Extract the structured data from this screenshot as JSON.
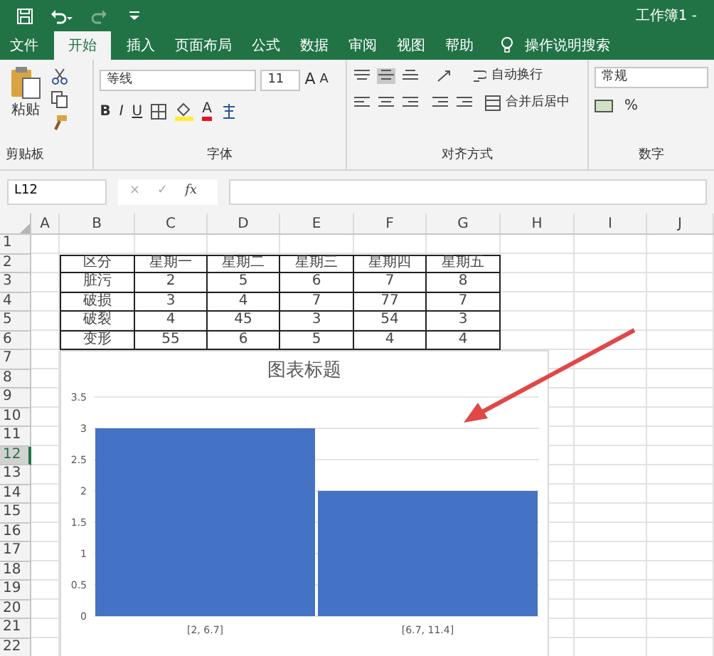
{
  "window": {
    "title": "工作簿1 -"
  },
  "tabs": [
    {
      "label": "文件",
      "selected": false
    },
    {
      "label": "开始",
      "selected": true
    },
    {
      "label": "插入",
      "selected": false
    },
    {
      "label": "页面布局",
      "selected": false
    },
    {
      "label": "公式",
      "selected": false
    },
    {
      "label": "数据",
      "selected": false
    },
    {
      "label": "审阅",
      "selected": false
    },
    {
      "label": "视图",
      "selected": false
    },
    {
      "label": "帮助",
      "selected": false
    }
  ],
  "tell_me": "操作说明搜索",
  "ribbon": {
    "clipboard": {
      "paste": "粘贴",
      "label": "剪贴板"
    },
    "font": {
      "name": "等线",
      "size": "11",
      "grow": "A",
      "shrink": "A",
      "bold": "B",
      "italic": "I",
      "underline": "U",
      "font_color": "A",
      "label": "字体"
    },
    "alignment": {
      "wrap": "自动换行",
      "merge": "合并后居中",
      "label": "对齐方式"
    },
    "number": {
      "format": "常规",
      "percent": "%",
      "label": "数字"
    }
  },
  "formula_bar": {
    "name_box": "L12",
    "cancel": "×",
    "enter": "✓",
    "fx": "fx"
  },
  "columns": [
    "A",
    "B",
    "C",
    "D",
    "E",
    "F",
    "G",
    "H",
    "I",
    "J"
  ],
  "rows": [
    {
      "label": "1",
      "selected": false
    },
    {
      "label": "2",
      "selected": false
    },
    {
      "label": "3",
      "selected": false
    },
    {
      "label": "4",
      "selected": false
    },
    {
      "label": "5",
      "selected": false
    },
    {
      "label": "6",
      "selected": false
    },
    {
      "label": "7",
      "selected": false
    },
    {
      "label": "8",
      "selected": false
    },
    {
      "label": "9",
      "selected": false
    },
    {
      "label": "10",
      "selected": false
    },
    {
      "label": "11",
      "selected": false
    },
    {
      "label": "12",
      "selected": true
    },
    {
      "label": "13",
      "selected": false
    },
    {
      "label": "14",
      "selected": false
    },
    {
      "label": "15",
      "selected": false
    },
    {
      "label": "16",
      "selected": false
    },
    {
      "label": "17",
      "selected": false
    },
    {
      "label": "18",
      "selected": false
    },
    {
      "label": "19",
      "selected": false
    },
    {
      "label": "20",
      "selected": false
    },
    {
      "label": "21",
      "selected": false
    },
    {
      "label": "22",
      "selected": false
    }
  ],
  "table": {
    "header": [
      "区分",
      "星期一",
      "星期二",
      "星期三",
      "星期四",
      "星期五"
    ],
    "rows": [
      [
        "脏污",
        "2",
        "5",
        "6",
        "7",
        "8"
      ],
      [
        "破损",
        "3",
        "4",
        "7",
        "77",
        "7"
      ],
      [
        "破裂",
        "4",
        "45",
        "3",
        "54",
        "3"
      ],
      [
        "变形",
        "55",
        "6",
        "5",
        "4",
        "4"
      ]
    ]
  },
  "chart": {
    "chart_data": {
      "type": "bar",
      "title": "图表标题",
      "categories": [
        "[2, 6.7]",
        "[6.7, 11.4]"
      ],
      "series": [
        {
          "color": "#4472c4",
          "values": [
            3,
            2
          ]
        }
      ],
      "grid": true,
      "ylim": [
        0,
        3.5
      ],
      "yticks": [
        0,
        0.5,
        1,
        1.5,
        2,
        2.5,
        3,
        3.5
      ]
    }
  }
}
